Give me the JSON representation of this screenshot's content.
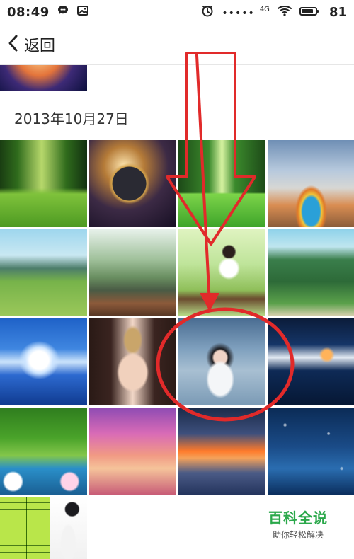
{
  "status_bar": {
    "time": "08:49",
    "left_icons": [
      "chat-icon",
      "image-icon"
    ],
    "signal_dots": "•••••",
    "network_label": "4G",
    "battery_level": "81"
  },
  "nav": {
    "back_label": "返回"
  },
  "gallery": {
    "date_header": "2013年10月27日",
    "photos": [
      "forest-path",
      "planet-space",
      "green-woods",
      "hot-spring",
      "mountain-valley",
      "lake-pier",
      "girl-on-swing",
      "green-hills",
      "snow-tree-lake",
      "actress-portrait",
      "fairy-portrait",
      "night-cabin",
      "lotus-pond",
      "pink-sunset",
      "sea-sunset",
      "starry-ocean",
      "document-table",
      "person-portrait"
    ]
  },
  "watermark": {
    "title": "百科全说",
    "subtitle": "助你轻松解决"
  },
  "colors": {
    "annotation_red": "#e12a2a"
  }
}
